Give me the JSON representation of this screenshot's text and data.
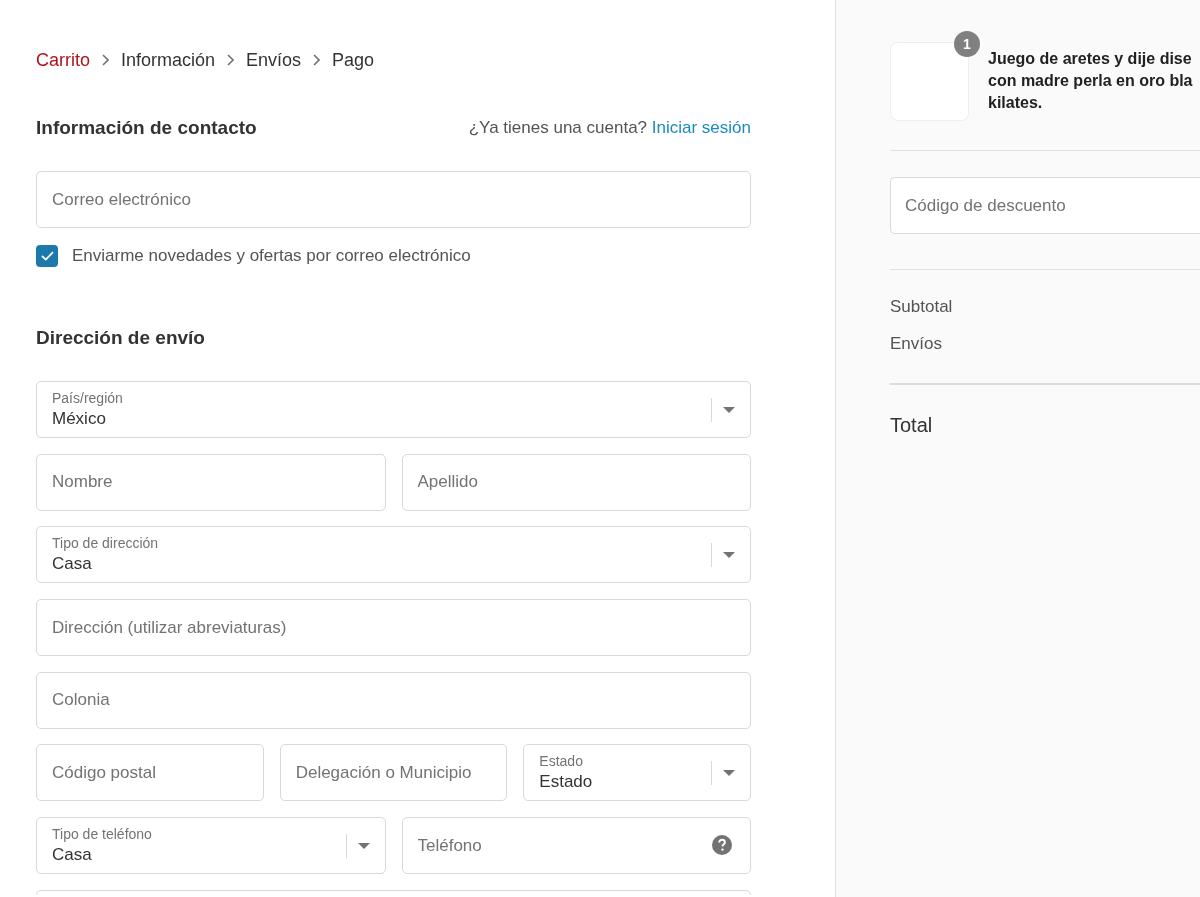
{
  "breadcrumb": [
    {
      "label": "Carrito",
      "link": true
    },
    {
      "label": "Información",
      "link": false
    },
    {
      "label": "Envíos",
      "link": false
    },
    {
      "label": "Pago",
      "link": false
    }
  ],
  "contact": {
    "heading": "Información de contacto",
    "login_prompt": "¿Ya tienes una cuenta?",
    "login_link": "Iniciar sesión",
    "email": {
      "placeholder": "Correo electrónico"
    },
    "newsletter": {
      "label": "Enviarme novedades y ofertas por correo electrónico",
      "checked": true
    }
  },
  "shipping": {
    "heading": "Dirección de envío",
    "rows": [
      [
        {
          "kind": "select",
          "label": "País/región",
          "value": "México"
        }
      ],
      [
        {
          "kind": "text",
          "placeholder": "Nombre"
        },
        {
          "kind": "text",
          "placeholder": "Apellido"
        }
      ],
      [
        {
          "kind": "select",
          "label": "Tipo de dirección",
          "value": "Casa"
        }
      ],
      [
        {
          "kind": "text",
          "placeholder": "Dirección (utilizar abreviaturas)"
        }
      ],
      [
        {
          "kind": "text",
          "placeholder": "Colonia"
        }
      ],
      [
        {
          "kind": "text",
          "placeholder": "Código postal"
        },
        {
          "kind": "text",
          "placeholder": "Delegación o Municipio"
        },
        {
          "kind": "select",
          "label": "Estado",
          "value": "Estado"
        }
      ],
      [
        {
          "kind": "select",
          "label": "Tipo de teléfono",
          "value": "Casa"
        },
        {
          "kind": "help",
          "placeholder": "Teléfono"
        }
      ],
      [
        {
          "kind": "cut_off"
        }
      ]
    ]
  },
  "summary": {
    "product": {
      "title_lines": [
        "Juego de aretes y dije dise",
        "con madre perla en oro bla",
        "kilates."
      ],
      "quantity": "1"
    },
    "discount": {
      "placeholder": "Código de descuento"
    },
    "lines": [
      "Subtotal",
      "Envíos"
    ],
    "total": "Total"
  }
}
